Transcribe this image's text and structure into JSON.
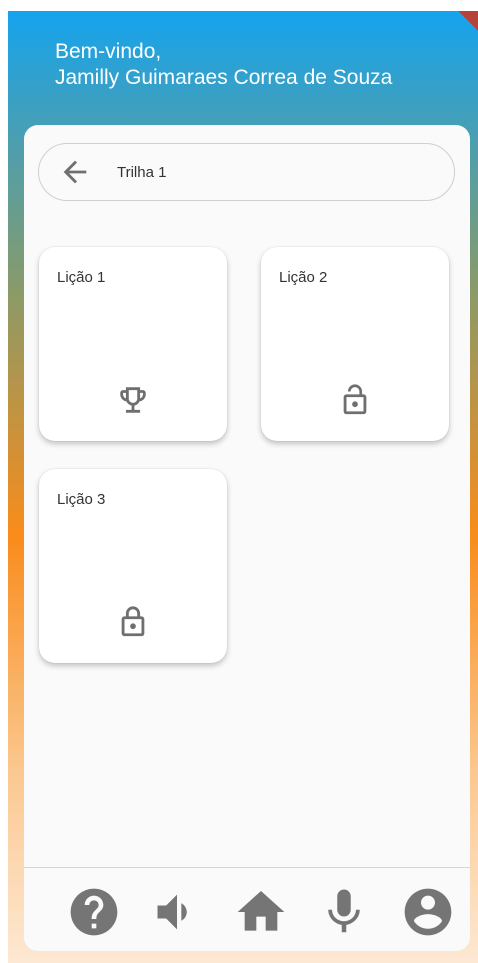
{
  "header": {
    "greeting_line1": "Bem-vindo,",
    "greeting_line2": "Jamilly Guimaraes Correa de Souza"
  },
  "trail": {
    "title": "Trilha 1",
    "back_icon": "arrow-back-icon"
  },
  "lessons": [
    {
      "label": "Lição 1",
      "icon": "trophy-icon",
      "status": "completed"
    },
    {
      "label": "Lição 2",
      "icon": "lock-open-icon",
      "status": "unlocked"
    },
    {
      "label": "Lição 3",
      "icon": "lock-icon",
      "status": "locked"
    }
  ],
  "bottom_nav": [
    {
      "icon": "help-icon"
    },
    {
      "icon": "volume-icon"
    },
    {
      "icon": "home-icon"
    },
    {
      "icon": "microphone-icon"
    },
    {
      "icon": "account-icon"
    }
  ],
  "colors": {
    "gradient_top": "#15a3ee",
    "gradient_mid": "#f98c1b",
    "gradient_bottom": "#fde8d3",
    "icon": "#6f6f6f",
    "nav_icon": "#757575",
    "text": "#333333"
  }
}
